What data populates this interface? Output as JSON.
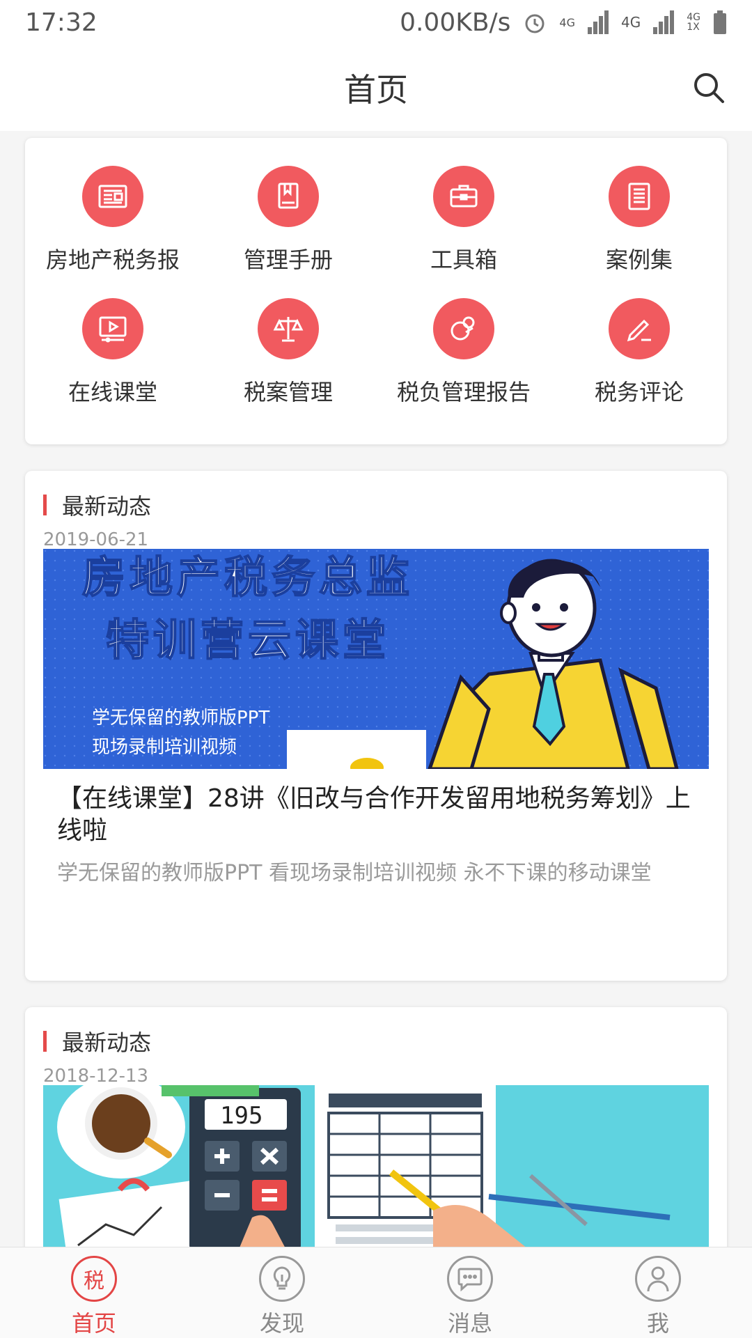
{
  "status_bar": {
    "time": "17:32",
    "net_speed": "0.00KB/s",
    "network_1": "4G",
    "network_2": "4G",
    "network_3": "4G",
    "network_3_sub": "1X"
  },
  "header": {
    "title": "首页",
    "search_icon": "search-icon"
  },
  "grid": {
    "items": [
      {
        "label": "房地产税务报",
        "icon": "newspaper-icon"
      },
      {
        "label": "管理手册",
        "icon": "book-icon"
      },
      {
        "label": "工具箱",
        "icon": "toolbox-icon"
      },
      {
        "label": "案例集",
        "icon": "document-icon"
      },
      {
        "label": "在线课堂",
        "icon": "video-icon"
      },
      {
        "label": "税案管理",
        "icon": "scale-icon"
      },
      {
        "label": "税负管理报告",
        "icon": "report-icon"
      },
      {
        "label": "税务评论",
        "icon": "pencil-icon"
      }
    ],
    "icon_color": "#f15a5f"
  },
  "news": [
    {
      "section": "最新动态",
      "date": "2019-06-21",
      "banner": {
        "line1": "房地产税务总监",
        "line2": "特训营云课堂",
        "line3": "学无保留的教师版PPT",
        "line4": "现场录制培训视频"
      },
      "title": "【在线课堂】28讲《旧改与合作开发留用地税务筹划》上线啦",
      "desc": "学无保留的教师版PPT 看现场录制培训视频 永不下课的移动课堂"
    },
    {
      "section": "最新动态",
      "date": "2018-12-13",
      "banner": {
        "display": "195"
      }
    }
  ],
  "tabbar": {
    "items": [
      {
        "label": "首页",
        "icon_char": "税",
        "active": true
      },
      {
        "label": "发现",
        "active": false
      },
      {
        "label": "消息",
        "active": false
      },
      {
        "label": "我",
        "active": false
      }
    ],
    "active_color": "#e34545"
  }
}
